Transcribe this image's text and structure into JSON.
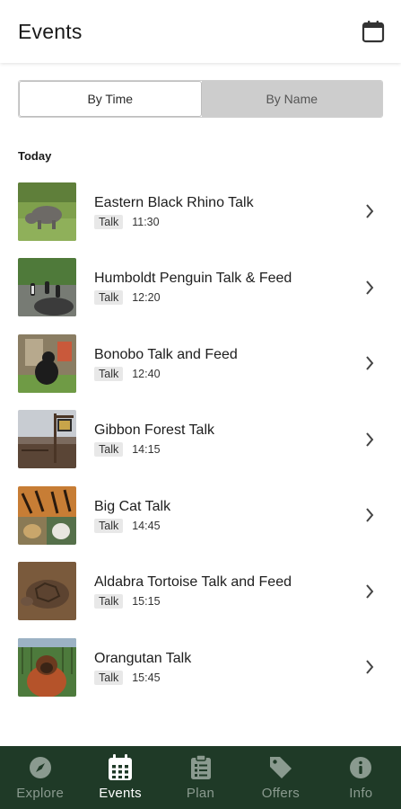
{
  "header": {
    "title": "Events",
    "calendar_icon": "calendar-icon"
  },
  "toggle": {
    "by_time": "By Time",
    "by_name": "By Name",
    "selected": "By Time"
  },
  "section": {
    "label": "Today"
  },
  "events": [
    {
      "title": "Eastern Black Rhino Talk",
      "tag": "Talk",
      "time": "11:30"
    },
    {
      "title": "Humboldt Penguin Talk & Feed",
      "tag": "Talk",
      "time": "12:20"
    },
    {
      "title": "Bonobo Talk and Feed",
      "tag": "Talk",
      "time": "12:40"
    },
    {
      "title": "Gibbon Forest Talk",
      "tag": "Talk",
      "time": "14:15"
    },
    {
      "title": "Big Cat Talk",
      "tag": "Talk",
      "time": "14:45"
    },
    {
      "title": "Aldabra Tortoise Talk and Feed",
      "tag": "Talk",
      "time": "15:15"
    },
    {
      "title": "Orangutan Talk",
      "tag": "Talk",
      "time": "15:45"
    }
  ],
  "tabbar": {
    "background": "#1f3a27",
    "active_color": "#ffffff",
    "inactive_color": "#8a9a8f",
    "items": [
      {
        "label": "Explore",
        "icon": "compass-icon"
      },
      {
        "label": "Events",
        "icon": "calendar-icon"
      },
      {
        "label": "Plan",
        "icon": "clipboard-icon"
      },
      {
        "label": "Offers",
        "icon": "tag-icon"
      },
      {
        "label": "Info",
        "icon": "info-icon"
      }
    ],
    "active": "Events"
  }
}
